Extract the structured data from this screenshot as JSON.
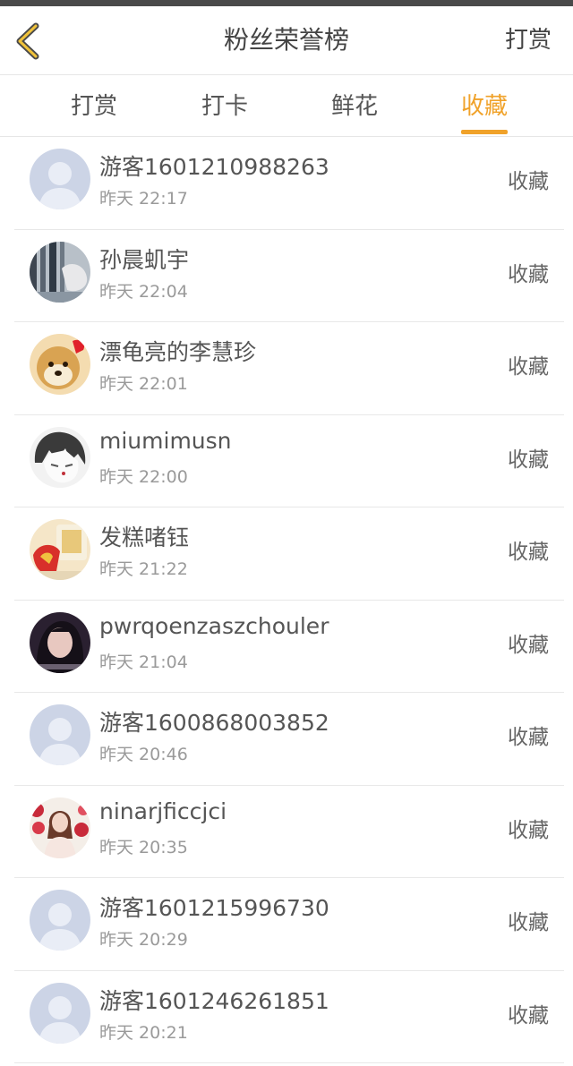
{
  "header": {
    "title": "粉丝荣誉榜",
    "action": "打赏"
  },
  "tabs": [
    {
      "label": "打赏"
    },
    {
      "label": "打卡"
    },
    {
      "label": "鲜花"
    },
    {
      "label": "收藏"
    }
  ],
  "active_tab": 3,
  "colors": {
    "accent": "#f0a22a",
    "text": "#555555",
    "subtext": "#9a9a9a",
    "divider": "#e8e8e8"
  },
  "fans": [
    {
      "name": "游客1601210988263",
      "time": "昨天 22:17",
      "action": "收藏",
      "avatar": "default-avatar"
    },
    {
      "name": "孙晨虮宇",
      "time": "昨天 22:04",
      "action": "收藏",
      "avatar": "photo-avatar"
    },
    {
      "name": "漂龟亮的李慧珍",
      "time": "昨天 22:01",
      "action": "收藏",
      "avatar": "dog-avatar"
    },
    {
      "name": "miumimusn",
      "time": "昨天 22:00",
      "action": "收藏",
      "avatar": "anime-avatar"
    },
    {
      "name": "发糕啫钰",
      "time": "昨天 21:22",
      "action": "收藏",
      "avatar": "food-avatar"
    },
    {
      "name": "pwrqoenzaszchouler",
      "time": "昨天 21:04",
      "action": "收藏",
      "avatar": "portrait-avatar"
    },
    {
      "name": "游客1600868003852",
      "time": "昨天 20:46",
      "action": "收藏",
      "avatar": "default-avatar"
    },
    {
      "name": "ninarjficcjci",
      "time": "昨天 20:35",
      "action": "收藏",
      "avatar": "flower-girl-avatar"
    },
    {
      "name": "游客1601215996730",
      "time": "昨天 20:29",
      "action": "收藏",
      "avatar": "default-avatar"
    },
    {
      "name": "游客1601246261851",
      "time": "昨天 20:21",
      "action": "收藏",
      "avatar": "default-avatar"
    }
  ]
}
